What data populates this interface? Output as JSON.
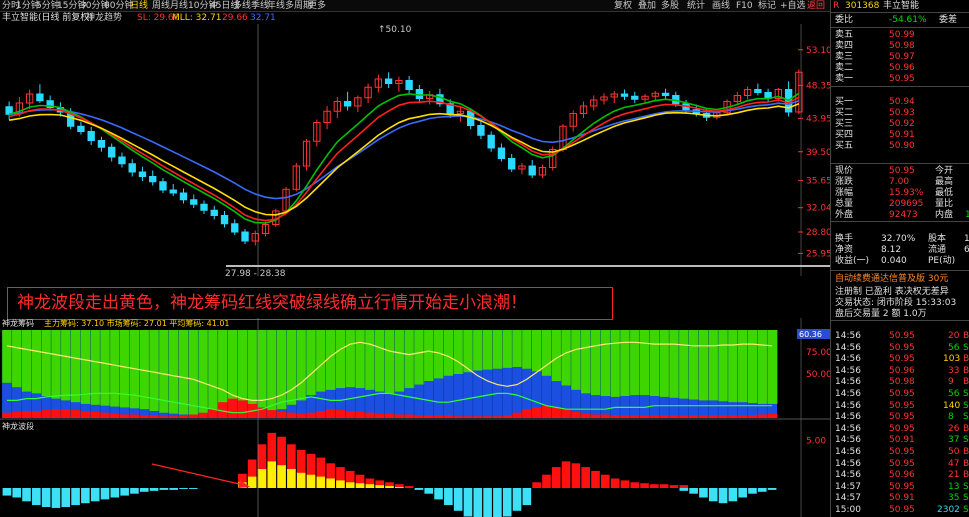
{
  "toolbar": {
    "periods": [
      "分时",
      "1分钟",
      "5分钟",
      "15分钟",
      "30分钟",
      "60分钟",
      "日线",
      "周线",
      "月线",
      "10分钟",
      "45日线",
      "多线",
      "季线",
      "年线",
      "多周期",
      "更多"
    ],
    "active_period": "日线",
    "right_items": [
      "复权",
      "叠加",
      "多股",
      "统计",
      "画线",
      "F10",
      "标记",
      "+自选",
      "返回"
    ]
  },
  "title": {
    "stock": "丰立智能(日线 前复权)",
    "indicator": "神龙趋势",
    "sl_label": "SL: 29.66",
    "mll_label": "MLL: 32.71",
    "v1": "29.66",
    "v2": "32.71"
  },
  "main_chart": {
    "y_ticks": [
      "53.10",
      "48.35",
      "43.95",
      "39.50",
      "35.65",
      "32.04",
      "28.80",
      "25.95"
    ],
    "high_label": "50.10",
    "low_label": "27.98 - 28.38",
    "markers": [
      "预",
      "新浪隆盛"
    ]
  },
  "chip_chart": {
    "title": "神龙筹码",
    "params": "主力筹码: 37.10   市场筹码: 27.01   平均筹码: 41.01",
    "current": "60.36",
    "y_ticks": [
      "75.00",
      "50.00"
    ]
  },
  "wave_chart": {
    "title": "神龙波段",
    "y_ticks": [
      "5.00"
    ]
  },
  "annotation": "神龙波段走出黄色，神龙筹码红线突破绿线确立行情开始走小浪潮！",
  "chart_data": [
    {
      "type": "line",
      "title": "",
      "series_colors": [
        "#3a6bff",
        "#00c000",
        "#ff2020",
        "#ffe000"
      ],
      "ylim": [
        24,
        56
      ],
      "note_high": 50.1,
      "note_low": [
        27.98,
        28.38
      ],
      "candles": [
        [
          45.5,
          46.2,
          43.8,
          44.5
        ],
        [
          44.6,
          46.8,
          44.2,
          46.0
        ],
        [
          46.0,
          47.8,
          45.2,
          47.2
        ],
        [
          47.2,
          48.5,
          46.0,
          46.3
        ],
        [
          46.3,
          47.0,
          45.0,
          45.4
        ],
        [
          45.4,
          46.1,
          44.2,
          44.8
        ],
        [
          44.8,
          45.3,
          42.5,
          42.9
        ],
        [
          42.9,
          43.5,
          41.8,
          42.2
        ],
        [
          42.2,
          42.8,
          40.4,
          41.0
        ],
        [
          41.0,
          41.5,
          39.5,
          40.1
        ],
        [
          40.1,
          40.6,
          38.2,
          38.8
        ],
        [
          38.8,
          39.4,
          37.4,
          37.9
        ],
        [
          37.9,
          38.5,
          36.2,
          36.8
        ],
        [
          36.8,
          37.5,
          35.6,
          36.2
        ],
        [
          36.2,
          37.0,
          35.0,
          35.5
        ],
        [
          35.5,
          36.0,
          34.0,
          34.4
        ],
        [
          34.4,
          35.2,
          33.6,
          34.0
        ],
        [
          34.0,
          34.6,
          32.6,
          33.1
        ],
        [
          33.1,
          33.8,
          32.0,
          32.5
        ],
        [
          32.5,
          33.0,
          31.2,
          31.7
        ],
        [
          31.7,
          32.3,
          30.5,
          31.0
        ],
        [
          31.0,
          31.6,
          29.4,
          29.9
        ],
        [
          29.9,
          30.5,
          28.4,
          28.8
        ],
        [
          28.8,
          29.2,
          27.2,
          27.6
        ],
        [
          27.6,
          29.0,
          27.0,
          28.6
        ],
        [
          28.6,
          30.2,
          28.2,
          29.8
        ],
        [
          29.8,
          31.9,
          29.5,
          31.6
        ],
        [
          31.6,
          34.8,
          31.2,
          34.5
        ],
        [
          34.5,
          38.0,
          34.2,
          37.6
        ],
        [
          37.6,
          41.2,
          37.0,
          40.9
        ],
        [
          40.9,
          43.8,
          40.2,
          43.4
        ],
        [
          43.4,
          45.6,
          42.5,
          44.9
        ],
        [
          44.9,
          46.8,
          44.0,
          46.2
        ],
        [
          46.2,
          47.5,
          45.0,
          45.6
        ],
        [
          45.6,
          47.0,
          44.8,
          46.7
        ],
        [
          46.7,
          48.6,
          46.0,
          48.1
        ],
        [
          48.1,
          49.8,
          47.4,
          49.2
        ],
        [
          49.2,
          50.1,
          48.0,
          48.6
        ],
        [
          48.6,
          49.5,
          47.5,
          49.0
        ],
        [
          49.0,
          49.6,
          47.2,
          47.8
        ],
        [
          47.8,
          48.4,
          46.0,
          46.6
        ],
        [
          46.6,
          47.6,
          45.8,
          47.1
        ],
        [
          47.1,
          47.9,
          45.5,
          45.9
        ],
        [
          45.9,
          46.5,
          44.0,
          44.6
        ],
        [
          44.6,
          45.5,
          43.5,
          44.9
        ],
        [
          44.9,
          45.3,
          42.5,
          43.0
        ],
        [
          43.0,
          43.6,
          41.2,
          41.7
        ],
        [
          41.7,
          42.2,
          39.5,
          40.0
        ],
        [
          40.0,
          40.6,
          38.2,
          38.6
        ],
        [
          38.6,
          39.2,
          36.8,
          37.2
        ],
        [
          37.2,
          38.0,
          36.5,
          37.6
        ],
        [
          37.6,
          38.4,
          36.0,
          36.4
        ],
        [
          36.4,
          37.8,
          36.0,
          37.4
        ],
        [
          37.4,
          40.2,
          37.0,
          39.8
        ],
        [
          39.8,
          43.2,
          39.5,
          42.9
        ],
        [
          42.9,
          45.0,
          42.2,
          44.6
        ],
        [
          44.6,
          46.2,
          44.0,
          45.6
        ],
        [
          45.6,
          47.0,
          45.0,
          46.4
        ],
        [
          46.4,
          47.3,
          45.8,
          46.8
        ],
        [
          46.8,
          47.6,
          46.0,
          47.2
        ],
        [
          47.2,
          47.8,
          46.4,
          46.9
        ],
        [
          46.9,
          47.5,
          46.0,
          46.5
        ],
        [
          46.5,
          47.2,
          45.8,
          46.9
        ],
        [
          46.9,
          47.6,
          46.2,
          47.3
        ],
        [
          47.3,
          47.9,
          46.6,
          47.0
        ],
        [
          47.0,
          47.5,
          45.5,
          45.9
        ],
        [
          45.9,
          46.4,
          44.6,
          45.1
        ],
        [
          45.1,
          45.8,
          44.2,
          44.6
        ],
        [
          44.6,
          45.2,
          43.6,
          44.1
        ],
        [
          44.1,
          45.0,
          43.8,
          44.7
        ],
        [
          44.7,
          46.5,
          44.5,
          46.2
        ],
        [
          46.2,
          47.5,
          45.8,
          47.0
        ],
        [
          47.0,
          48.2,
          46.5,
          47.8
        ],
        [
          47.8,
          48.6,
          47.0,
          47.4
        ],
        [
          47.4,
          47.9,
          46.2,
          46.6
        ],
        [
          46.6,
          48.0,
          46.2,
          47.8
        ],
        [
          47.8,
          48.9,
          44.2,
          44.8
        ],
        [
          44.8,
          50.5,
          44.5,
          50.1
        ]
      ]
    },
    {
      "type": "area",
      "title": "神龙筹码",
      "ylim": [
        0,
        100
      ],
      "main": [
        60,
        65,
        70,
        72,
        75,
        78,
        80,
        82,
        84,
        85,
        86,
        87,
        88,
        89,
        90,
        92,
        94,
        95,
        96,
        97,
        98,
        99,
        100,
        100,
        100,
        99,
        97,
        94,
        90,
        85,
        80,
        74,
        70,
        68,
        66,
        65,
        66,
        68,
        70,
        72,
        70,
        66,
        62,
        58,
        55,
        52,
        50,
        48,
        46,
        45,
        44,
        43,
        42,
        44,
        47,
        52,
        58,
        63,
        68,
        72,
        74,
        75,
        76,
        75,
        74,
        74,
        75,
        76,
        77,
        78,
        79,
        80,
        80,
        81,
        82,
        82,
        83,
        84,
        84
      ],
      "red": [
        6,
        7,
        8,
        8,
        9,
        10,
        10,
        9,
        8,
        7,
        6,
        5,
        4,
        4,
        3,
        3,
        2,
        2,
        3,
        4,
        6,
        10,
        18,
        22,
        20,
        16,
        12,
        9,
        7,
        6,
        5,
        6,
        8,
        10,
        9,
        8,
        7,
        6,
        5,
        5,
        4,
        4,
        3,
        3,
        3,
        3,
        2,
        2,
        2,
        2,
        2,
        3,
        6,
        10,
        12,
        14,
        12,
        9,
        7,
        5,
        4,
        4,
        3,
        3,
        3,
        3,
        3,
        3,
        3,
        3,
        3,
        3,
        3,
        3,
        3,
        3,
        3,
        4,
        5
      ],
      "yellow_line": [
        82,
        80,
        78,
        76,
        74,
        72,
        70,
        68,
        66,
        64,
        62,
        60,
        58,
        56,
        54,
        52,
        50,
        48,
        46,
        44,
        40,
        36,
        32,
        26,
        22,
        20,
        20,
        22,
        26,
        32,
        40,
        50,
        60,
        70,
        78,
        84,
        86,
        84,
        80,
        76,
        74,
        72,
        74,
        76,
        74,
        70,
        64,
        56,
        48,
        42,
        38,
        36,
        38,
        44,
        52,
        60,
        68,
        74,
        78,
        80,
        82,
        84,
        85,
        86,
        86,
        85,
        84,
        84,
        84,
        83,
        82,
        82,
        82,
        83,
        83,
        84,
        84,
        83,
        82
      ],
      "green_line": [
        20,
        20,
        22,
        22,
        24,
        25,
        26,
        26,
        27,
        28,
        28,
        28,
        27,
        26,
        24,
        22,
        20,
        18,
        16,
        14,
        12,
        10,
        8,
        6,
        6,
        8,
        10,
        14,
        18,
        20,
        22,
        24,
        22,
        20,
        20,
        22,
        24,
        26,
        28,
        28,
        26,
        24,
        22,
        20,
        18,
        18,
        20,
        22,
        24,
        26,
        28,
        28,
        26,
        22,
        18,
        14,
        12,
        10,
        10,
        10,
        10,
        10,
        12,
        12,
        12,
        12,
        14,
        14,
        14,
        14,
        14,
        14,
        14,
        14,
        14,
        14,
        14,
        14,
        14
      ]
    },
    {
      "type": "bar",
      "title": "神龙波段",
      "ylim": [
        -6,
        6
      ],
      "red": [
        0,
        0,
        0,
        0,
        0,
        0,
        0,
        0,
        0,
        0,
        0,
        0,
        0,
        0,
        0,
        0,
        0,
        0,
        0,
        0,
        0,
        0,
        0,
        0,
        1.5,
        3.0,
        4.6,
        5.8,
        5.4,
        4.6,
        4.0,
        3.6,
        3.2,
        2.6,
        2.2,
        1.8,
        1.4,
        1.0,
        0.8,
        0.6,
        0.4,
        0.2,
        0,
        0,
        0,
        0,
        0,
        0,
        0,
        0,
        0,
        0,
        0,
        0,
        0.6,
        1.4,
        2.2,
        2.8,
        2.6,
        2.2,
        1.8,
        1.4,
        1.0,
        0.8,
        0.6,
        0.5,
        0.4,
        0.4,
        0.3,
        0.3,
        0,
        0,
        0,
        0,
        0,
        0,
        0,
        0,
        0
      ],
      "yellow": [
        0,
        0,
        0,
        0,
        0,
        0,
        0,
        0,
        0,
        0,
        0,
        0,
        0,
        0,
        0,
        0,
        0,
        0,
        0,
        0,
        0,
        0,
        0,
        0,
        0.6,
        1.2,
        2.0,
        2.8,
        2.4,
        2.0,
        1.6,
        1.4,
        1.2,
        1.0,
        0.8,
        0.6,
        0.5,
        0.4,
        0.3,
        0.2,
        0.1,
        0,
        0,
        0,
        0,
        0,
        0,
        0,
        0,
        0,
        0,
        0,
        0,
        0,
        0,
        0,
        0,
        0,
        0,
        0,
        0,
        0,
        0,
        0,
        0,
        0,
        0,
        0,
        0,
        0,
        0,
        0,
        0,
        0,
        0,
        0,
        0,
        0,
        0
      ],
      "cyan": [
        -0.8,
        -1.0,
        -1.4,
        -1.8,
        -2.0,
        -2.1,
        -2.0,
        -1.8,
        -1.6,
        -1.4,
        -1.2,
        -1.0,
        -0.8,
        -0.6,
        -0.4,
        -0.3,
        -0.2,
        -0.2,
        -0.1,
        -0.1,
        0,
        0,
        0,
        0,
        0,
        0,
        0,
        0,
        0,
        0,
        0,
        0,
        0,
        0,
        0,
        0,
        0,
        0,
        0,
        0,
        0,
        0,
        -0.2,
        -0.6,
        -1.2,
        -1.8,
        -2.4,
        -3.0,
        -3.4,
        -3.6,
        -3.4,
        -3.0,
        -2.4,
        -1.8,
        0,
        0,
        0,
        0,
        0,
        0,
        0,
        0,
        0,
        0,
        0,
        0,
        0,
        0,
        0,
        -0.3,
        -0.6,
        -1.0,
        -1.4,
        -1.6,
        -1.4,
        -1.0,
        -0.6,
        -0.4,
        -0.2
      ]
    }
  ],
  "quote": {
    "code": "301368",
    "name": "丰立智能",
    "weibi_label": "委比",
    "weibi_value": "-54.61%",
    "weicha_label": "委差",
    "asks": [
      {
        "label": "卖五",
        "price": "50.99"
      },
      {
        "label": "卖四",
        "price": "50.98"
      },
      {
        "label": "卖三",
        "price": "50.97"
      },
      {
        "label": "卖二",
        "price": "50.96"
      },
      {
        "label": "卖一",
        "price": "50.95"
      }
    ],
    "bids": [
      {
        "label": "买一",
        "price": "50.94"
      },
      {
        "label": "买二",
        "price": "50.93"
      },
      {
        "label": "买三",
        "price": "50.92"
      },
      {
        "label": "买四",
        "price": "50.91"
      },
      {
        "label": "买五",
        "price": "50.90"
      }
    ],
    "stats": [
      {
        "k1": "现价",
        "v1": "50.95",
        "k2": "今开"
      },
      {
        "k1": "涨跌",
        "v1": "7.00",
        "k2": "最高"
      },
      {
        "k1": "涨幅",
        "v1": "15.93%",
        "k2": "最低"
      },
      {
        "k1": "总量",
        "v1": "209695",
        "k2": "量比"
      },
      {
        "k1": "外盘",
        "v1": "92473",
        "k2": "内盘",
        "v2": "1"
      }
    ],
    "stats2": [
      {
        "k1": "换手",
        "v1": "32.70%",
        "k2": "股本",
        "v2": "1"
      },
      {
        "k1": "净资",
        "v1": "8.12",
        "k2": "流通",
        "v2": "6"
      },
      {
        "k1": "收益(一)",
        "v1": "0.040",
        "k2": "PE(动)"
      }
    ],
    "notice1": "自动续费通达信普及版  30元",
    "notice2": "注册制 已盈利 表决权无差异",
    "notice3": "交易状态: 闭市阶段 15:33:03",
    "notice4": "盘后交易量 2 额 1.0万",
    "ticks": [
      {
        "t": "14:56",
        "p": "50.95",
        "v": "20",
        "s": "B"
      },
      {
        "t": "14:56",
        "p": "50.95",
        "v": "56",
        "s": "S"
      },
      {
        "t": "14:56",
        "p": "50.95",
        "v": "103",
        "s": "B"
      },
      {
        "t": "14:56",
        "p": "50.96",
        "v": "33",
        "s": "B"
      },
      {
        "t": "14:56",
        "p": "50.98",
        "v": "9",
        "s": "B"
      },
      {
        "t": "14:56",
        "p": "50.95",
        "v": "56",
        "s": "S"
      },
      {
        "t": "14:56",
        "p": "50.95",
        "v": "140",
        "s": "S"
      },
      {
        "t": "14:56",
        "p": "50.95",
        "v": "8",
        "s": "S"
      },
      {
        "t": "14:56",
        "p": "50.95",
        "v": "26",
        "s": "B"
      },
      {
        "t": "14:56",
        "p": "50.91",
        "v": "37",
        "s": "S"
      },
      {
        "t": "14:56",
        "p": "50.95",
        "v": "50",
        "s": "B"
      },
      {
        "t": "14:56",
        "p": "50.95",
        "v": "47",
        "s": "B"
      },
      {
        "t": "14:56",
        "p": "50.96",
        "v": "21",
        "s": "B"
      },
      {
        "t": "14:57",
        "p": "50.95",
        "v": "13",
        "s": "S"
      },
      {
        "t": "14:57",
        "p": "50.91",
        "v": "35",
        "s": "S"
      },
      {
        "t": "15:00",
        "p": "50.95",
        "v": "2302",
        "s": "S"
      }
    ]
  }
}
